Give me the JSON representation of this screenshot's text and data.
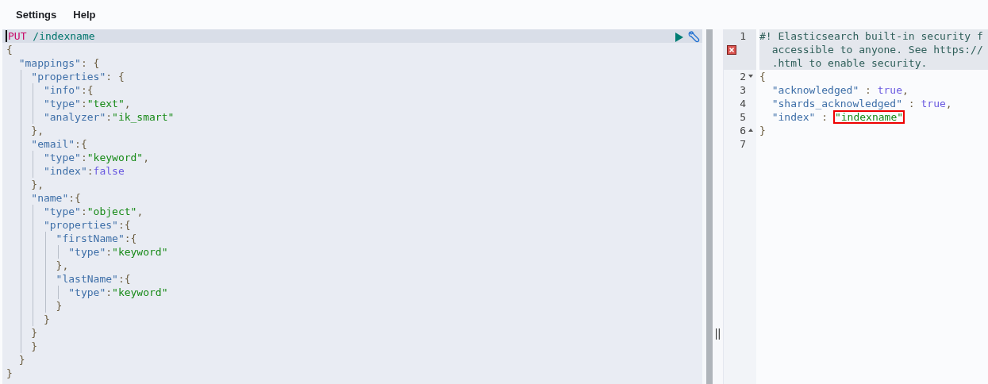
{
  "menu": [
    {
      "label": "Settings"
    },
    {
      "label": "Help"
    }
  ],
  "request_editor": {
    "lines": [
      [
        {
          "kind": "method",
          "text": "PUT"
        },
        {
          "kind": "path",
          "text": " /indexname"
        }
      ],
      [
        {
          "kind": "punct",
          "text": "{"
        }
      ],
      [
        {
          "kind": "key",
          "text": "  \"mappings\""
        },
        {
          "kind": "punct",
          "text": ": {"
        }
      ],
      [
        {
          "kind": "key",
          "text": "    \"properties\""
        },
        {
          "kind": "punct",
          "text": ": {"
        }
      ],
      [
        {
          "kind": "key",
          "text": "      \"info\""
        },
        {
          "kind": "punct",
          "text": ":{"
        }
      ],
      [
        {
          "kind": "key",
          "text": "      \"type\""
        },
        {
          "kind": "punct",
          "text": ":"
        },
        {
          "kind": "string",
          "text": "\"text\""
        },
        {
          "kind": "punct",
          "text": ","
        }
      ],
      [
        {
          "kind": "key",
          "text": "      \"analyzer\""
        },
        {
          "kind": "punct",
          "text": ":"
        },
        {
          "kind": "string",
          "text": "\"ik_smart\""
        }
      ],
      [
        {
          "kind": "punct",
          "text": "    },"
        }
      ],
      [
        {
          "kind": "key",
          "text": "    \"email\""
        },
        {
          "kind": "punct",
          "text": ":{"
        }
      ],
      [
        {
          "kind": "key",
          "text": "      \"type\""
        },
        {
          "kind": "punct",
          "text": ":"
        },
        {
          "kind": "string",
          "text": "\"keyword\""
        },
        {
          "kind": "punct",
          "text": ","
        }
      ],
      [
        {
          "kind": "key",
          "text": "      \"index\""
        },
        {
          "kind": "punct",
          "text": ":"
        },
        {
          "kind": "literal",
          "text": "false"
        }
      ],
      [
        {
          "kind": "punct",
          "text": "    },"
        }
      ],
      [
        {
          "kind": "key",
          "text": "    \"name\""
        },
        {
          "kind": "punct",
          "text": ":{"
        }
      ],
      [
        {
          "kind": "key",
          "text": "      \"type\""
        },
        {
          "kind": "punct",
          "text": ":"
        },
        {
          "kind": "string",
          "text": "\"object\""
        },
        {
          "kind": "punct",
          "text": ","
        }
      ],
      [
        {
          "kind": "key",
          "text": "      \"properties\""
        },
        {
          "kind": "punct",
          "text": ":{"
        }
      ],
      [
        {
          "kind": "key",
          "text": "        \"firstName\""
        },
        {
          "kind": "punct",
          "text": ":{"
        }
      ],
      [
        {
          "kind": "key",
          "text": "          \"type\""
        },
        {
          "kind": "punct",
          "text": ":"
        },
        {
          "kind": "string",
          "text": "\"keyword\""
        }
      ],
      [
        {
          "kind": "punct",
          "text": "        },"
        }
      ],
      [
        {
          "kind": "key",
          "text": "        \"lastName\""
        },
        {
          "kind": "punct",
          "text": ":{"
        }
      ],
      [
        {
          "kind": "key",
          "text": "          \"type\""
        },
        {
          "kind": "punct",
          "text": ":"
        },
        {
          "kind": "string",
          "text": "\"keyword\""
        }
      ],
      [
        {
          "kind": "punct",
          "text": "        }"
        }
      ],
      [
        {
          "kind": "punct",
          "text": "      }"
        }
      ],
      [
        {
          "kind": "punct",
          "text": "    }"
        }
      ],
      [
        {
          "kind": "punct",
          "text": "    }"
        }
      ],
      [
        {
          "kind": "punct",
          "text": "  }"
        }
      ],
      [
        {
          "kind": "punct",
          "text": "}"
        }
      ]
    ]
  },
  "splitter": {
    "handle": "||"
  },
  "response_editor": {
    "lines": [
      {
        "number": "1",
        "error": true,
        "rows": [
          [
            {
              "kind": "comment",
              "text": "#! Elasticsearch built-in security f"
            }
          ],
          [
            {
              "kind": "comment",
              "text": "  accessible to anyone. See https://"
            }
          ],
          [
            {
              "kind": "comment",
              "text": "  .html to enable security."
            }
          ]
        ]
      },
      {
        "number": "2",
        "fold_start": true,
        "rows": [
          [
            {
              "kind": "punct",
              "text": "{"
            }
          ]
        ]
      },
      {
        "number": "3",
        "rows": [
          [
            {
              "kind": "key",
              "text": "  \"acknowledged\""
            },
            {
              "kind": "punct",
              "text": " : "
            },
            {
              "kind": "literal",
              "text": "true"
            },
            {
              "kind": "punct",
              "text": ","
            }
          ]
        ]
      },
      {
        "number": "4",
        "rows": [
          [
            {
              "kind": "key",
              "text": "  \"shards_acknowledged\""
            },
            {
              "kind": "punct",
              "text": " : "
            },
            {
              "kind": "literal",
              "text": "true"
            },
            {
              "kind": "punct",
              "text": ","
            }
          ]
        ]
      },
      {
        "number": "5",
        "rows": [
          [
            {
              "kind": "key",
              "text": "  \"index\""
            },
            {
              "kind": "punct",
              "text": " : "
            },
            {
              "kind": "string",
              "text": "\"indexname\"",
              "highlighted": true
            }
          ]
        ]
      },
      {
        "number": "6",
        "fold_end": true,
        "rows": [
          [
            {
              "kind": "punct",
              "text": "}"
            }
          ]
        ]
      },
      {
        "number": "7",
        "rows": [
          []
        ]
      }
    ]
  }
}
